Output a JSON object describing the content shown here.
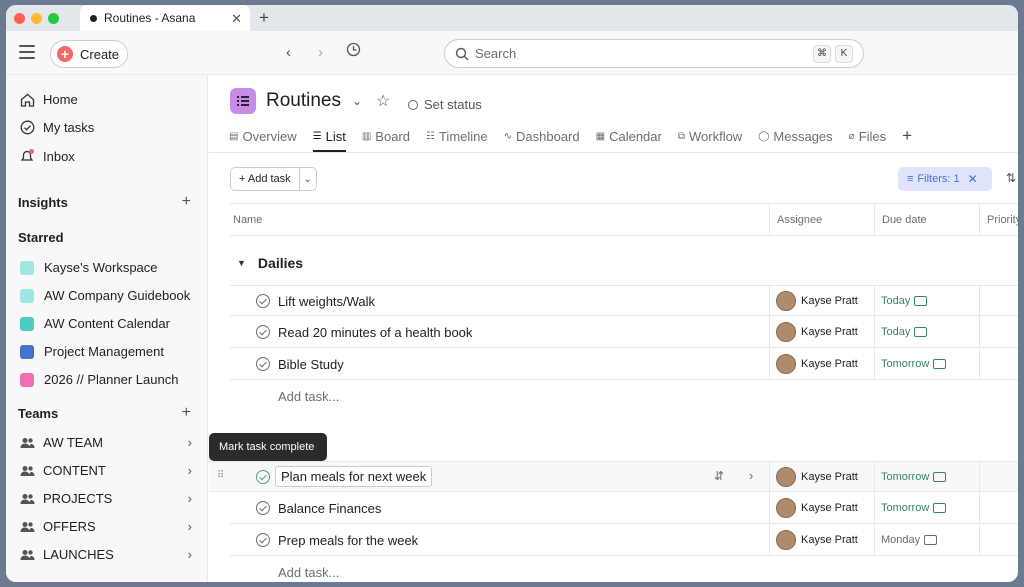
{
  "browser": {
    "tab_title": "Routines - Asana",
    "close_glyph": "✕",
    "new_tab_glyph": "+"
  },
  "topbar": {
    "create_label": "Create",
    "search_placeholder": "Search",
    "shortcut_keys": [
      "⌘",
      "K"
    ]
  },
  "sidebar": {
    "main_items": [
      {
        "label": "Home",
        "icon": "home-icon"
      },
      {
        "label": "My tasks",
        "icon": "check-circle-icon"
      },
      {
        "label": "Inbox",
        "icon": "bell-icon"
      }
    ],
    "insights_label": "Insights",
    "starred_label": "Starred",
    "starred_items": [
      {
        "label": "Kayse's Workspace",
        "color": "#9ee7e3"
      },
      {
        "label": "AW Company Guidebook",
        "color": "#9ee7e3"
      },
      {
        "label": "AW Content Calendar",
        "color": "#4ecbc4"
      },
      {
        "label": "Project Management",
        "color": "#4573d2"
      },
      {
        "label": "2026 // Planner Launch",
        "color": "#f26fb2"
      }
    ],
    "teams_label": "Teams",
    "teams": [
      {
        "label": "AW TEAM"
      },
      {
        "label": "CONTENT"
      },
      {
        "label": "PROJECTS"
      },
      {
        "label": "OFFERS"
      },
      {
        "label": "LAUNCHES"
      }
    ]
  },
  "project": {
    "title": "Routines",
    "set_status": "Set status",
    "icon_color": "#c78ce8",
    "tabs": [
      {
        "label": "Overview",
        "icon": "overview-icon"
      },
      {
        "label": "List",
        "icon": "list-icon",
        "active": true
      },
      {
        "label": "Board",
        "icon": "board-icon"
      },
      {
        "label": "Timeline",
        "icon": "timeline-icon"
      },
      {
        "label": "Dashboard",
        "icon": "dashboard-icon"
      },
      {
        "label": "Calendar",
        "icon": "calendar-icon"
      },
      {
        "label": "Workflow",
        "icon": "workflow-icon"
      },
      {
        "label": "Messages",
        "icon": "messages-icon"
      },
      {
        "label": "Files",
        "icon": "files-icon"
      }
    ]
  },
  "toolbar": {
    "add_task_label": "+ Add task",
    "filters_label": "Filters: 1"
  },
  "table": {
    "columns": [
      "Name",
      "Assignee",
      "Due date",
      "Priority"
    ]
  },
  "section": {
    "name": "Dailies",
    "add_task_label": "Add task..."
  },
  "tasks_dailies": [
    {
      "name": "Lift weights/Walk",
      "assignee": "Kayse Pratt",
      "due": "Today"
    },
    {
      "name": "Read 20 minutes of a health book",
      "assignee": "Kayse Pratt",
      "due": "Today"
    },
    {
      "name": "Bible Study",
      "assignee": "Kayse Pratt",
      "due": "Tomorrow"
    }
  ],
  "tasks_second": [
    {
      "name": "Plan meals for next week",
      "assignee": "Kayse Pratt",
      "due": "Tomorrow"
    },
    {
      "name": "Balance Finances",
      "assignee": "Kayse Pratt",
      "due": "Tomorrow"
    },
    {
      "name": "Prep meals for the week",
      "assignee": "Kayse Pratt",
      "due": "Monday"
    }
  ],
  "tooltip": "Mark task complete",
  "colors": {
    "due_green": "#378662",
    "create_red": "#f06a6a",
    "filter_blue": "#4573d2"
  }
}
